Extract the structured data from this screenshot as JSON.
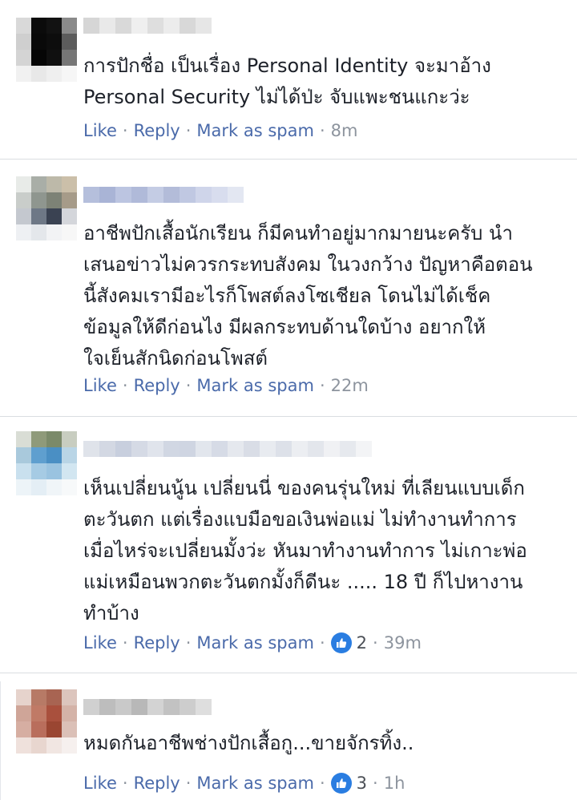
{
  "actions": {
    "like": "Like",
    "reply": "Reply",
    "spam": "Mark as spam",
    "sep": "·"
  },
  "colors": {
    "link": "#4a6aaa",
    "meta": "#8d949e",
    "text": "#1d2129",
    "like_badge": "#2a7de1"
  },
  "icons": {
    "reaction": "thumbs-up-icon"
  },
  "comments": [
    {
      "text": "การปักชื่อ เป็นเรื่อง Personal Identity จะมาอ้าง\nPersonal Security ไม่ได้ป่ะ จับแพะชนแกะว่ะ",
      "time": "8m",
      "reactions": ""
    },
    {
      "text": "อาชีพปักเสื้อนักเรียน ก็มีคนทำอยู่มากมายนะครับ นำ\nเสนอข่าวไม่ควรกระทบสังคม ในวงกว้าง ปัญหาคือตอน\nนี้สังคมเรามีอะไรก็โพสต์ลงโซเชียล โดนไม่ได้เช็ค\nข้อมูลให้ดีก่อนไง มีผลกระทบด้านใดบ้าง อยากให้\nใจเย็นสักนิดก่อนโพสต์",
      "time": "22m",
      "reactions": ""
    },
    {
      "text": "เห็นเปลี่ยนนู้น เปลี่ยนนี่ ของคนรุ่นใหม่ ที่เลียนแบบเด็ก\nตะวันตก แต่เรื่องแบมือขอเงินพ่อแม่ ไม่ทำงานทำการ\nเมื่อไหร่จะเปลี่ยนมั้งว่ะ หันมาทำงานทำการ ไม่เกาะพ่อ\nแม่เหมือนพวกตะวันตกมั้งก็ดีนะ ..... 18 ปี ก็ไปหางาน\nทำบ้าง",
      "time": "39m",
      "reactions": "2"
    },
    {
      "text": "หมดกันอาชีพช่างปักเสื้อกู...ขายจักรทิ้ง..",
      "time": "1h",
      "reactions": "3"
    }
  ]
}
